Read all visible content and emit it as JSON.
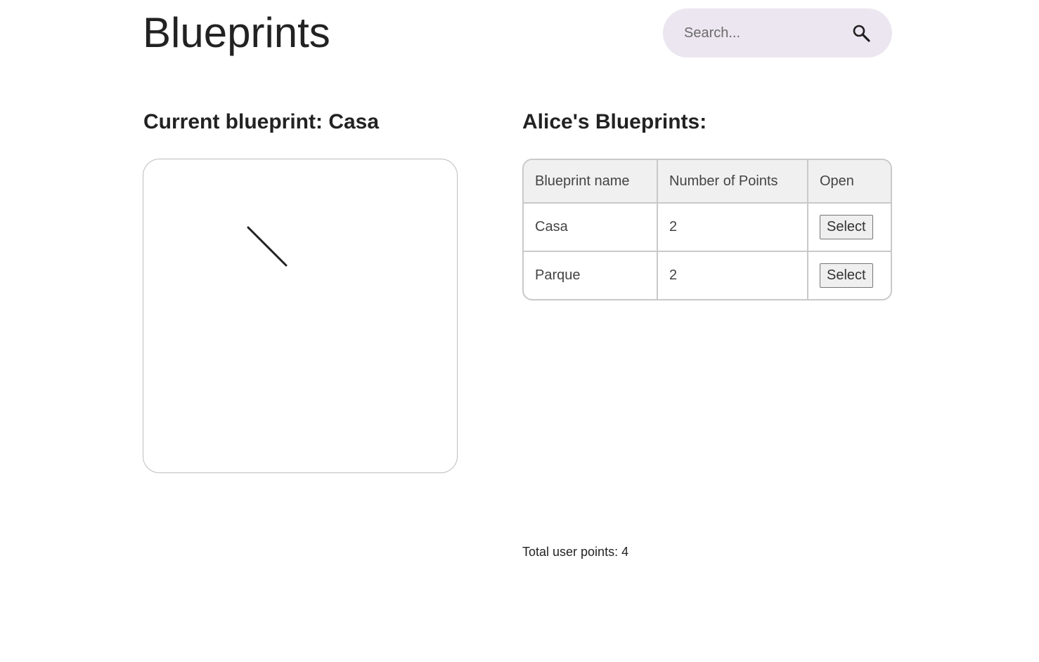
{
  "header": {
    "title": "Blueprints",
    "search_placeholder": "Search...",
    "search_icon": "search-icon"
  },
  "current": {
    "heading": "Current blueprint: Casa",
    "blueprint_name": "Casa"
  },
  "user": {
    "heading": "Alice's Blueprints:",
    "table": {
      "columns": [
        "Blueprint name",
        "Number of Points",
        "Open"
      ],
      "rows": [
        {
          "name": "Casa",
          "points": "2",
          "action_label": "Select"
        },
        {
          "name": "Parque",
          "points": "2",
          "action_label": "Select"
        }
      ]
    },
    "total_points_text": "Total user points: 4"
  },
  "colors": {
    "search_bg": "#ebe6f0",
    "table_header_bg": "#f0f0f0",
    "table_border": "#c9c9c9",
    "drawing_stroke": "#222222"
  }
}
